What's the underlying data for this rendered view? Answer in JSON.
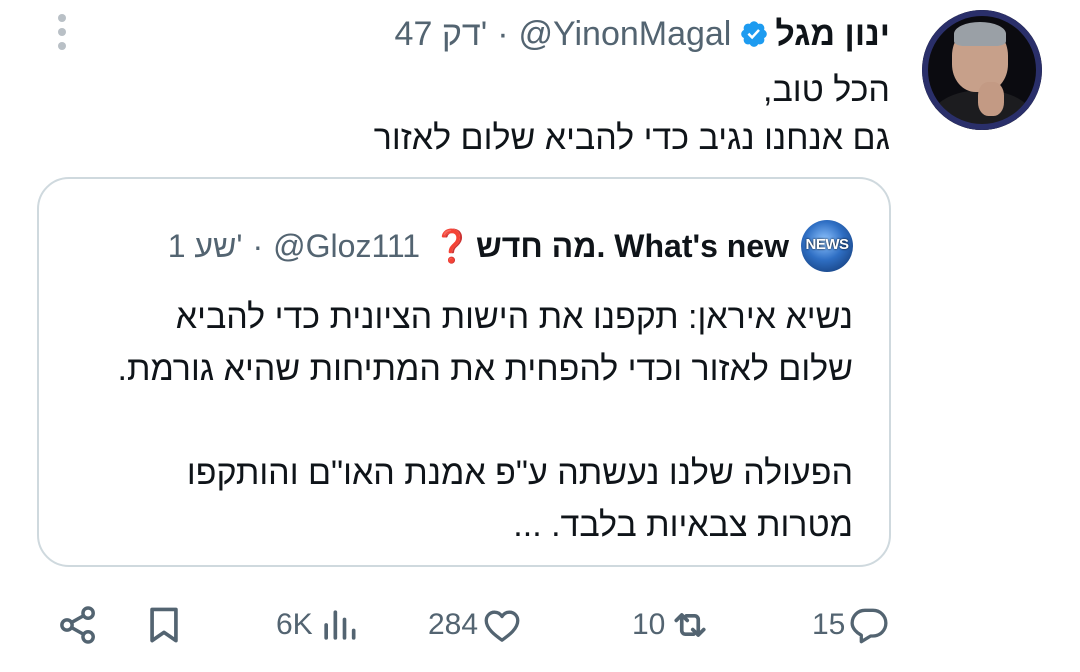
{
  "post": {
    "author_name": "ינון מגל",
    "handle": "@YinonMagal",
    "separator": "·",
    "time": "47 דק'",
    "text_lines": [
      "הכל טוב,",
      "גם אנחנו נגיב כדי להביא שלום לאזור"
    ]
  },
  "quoted": {
    "avatar_label": "NEWS",
    "author_name": "מה חדש. What's new",
    "emoji": "❓",
    "handle": "@Gloz111",
    "separator": "·",
    "time": "1 שע'",
    "paragraph1": [
      "נשיא איראן: תקפנו את הישות הציונית כדי להביא",
      "שלום לאזור וכדי להפחית את המתיחות שהיא גורמת."
    ],
    "paragraph2": [
      "הפעולה שלנו נעשתה ע\"פ אמנת האו\"ם והותקפו",
      "מטרות צבאיות בלבד. ..."
    ]
  },
  "actions": {
    "replies": "15",
    "reposts": "10",
    "likes": "284",
    "views": "6K",
    "icons": [
      "reply-icon",
      "repost-icon",
      "like-icon",
      "views-icon",
      "bookmark-icon",
      "share-icon"
    ]
  },
  "colors": {
    "verified": "#1d9bf0",
    "secondary_text": "#536471",
    "border": "#cfd9de"
  }
}
